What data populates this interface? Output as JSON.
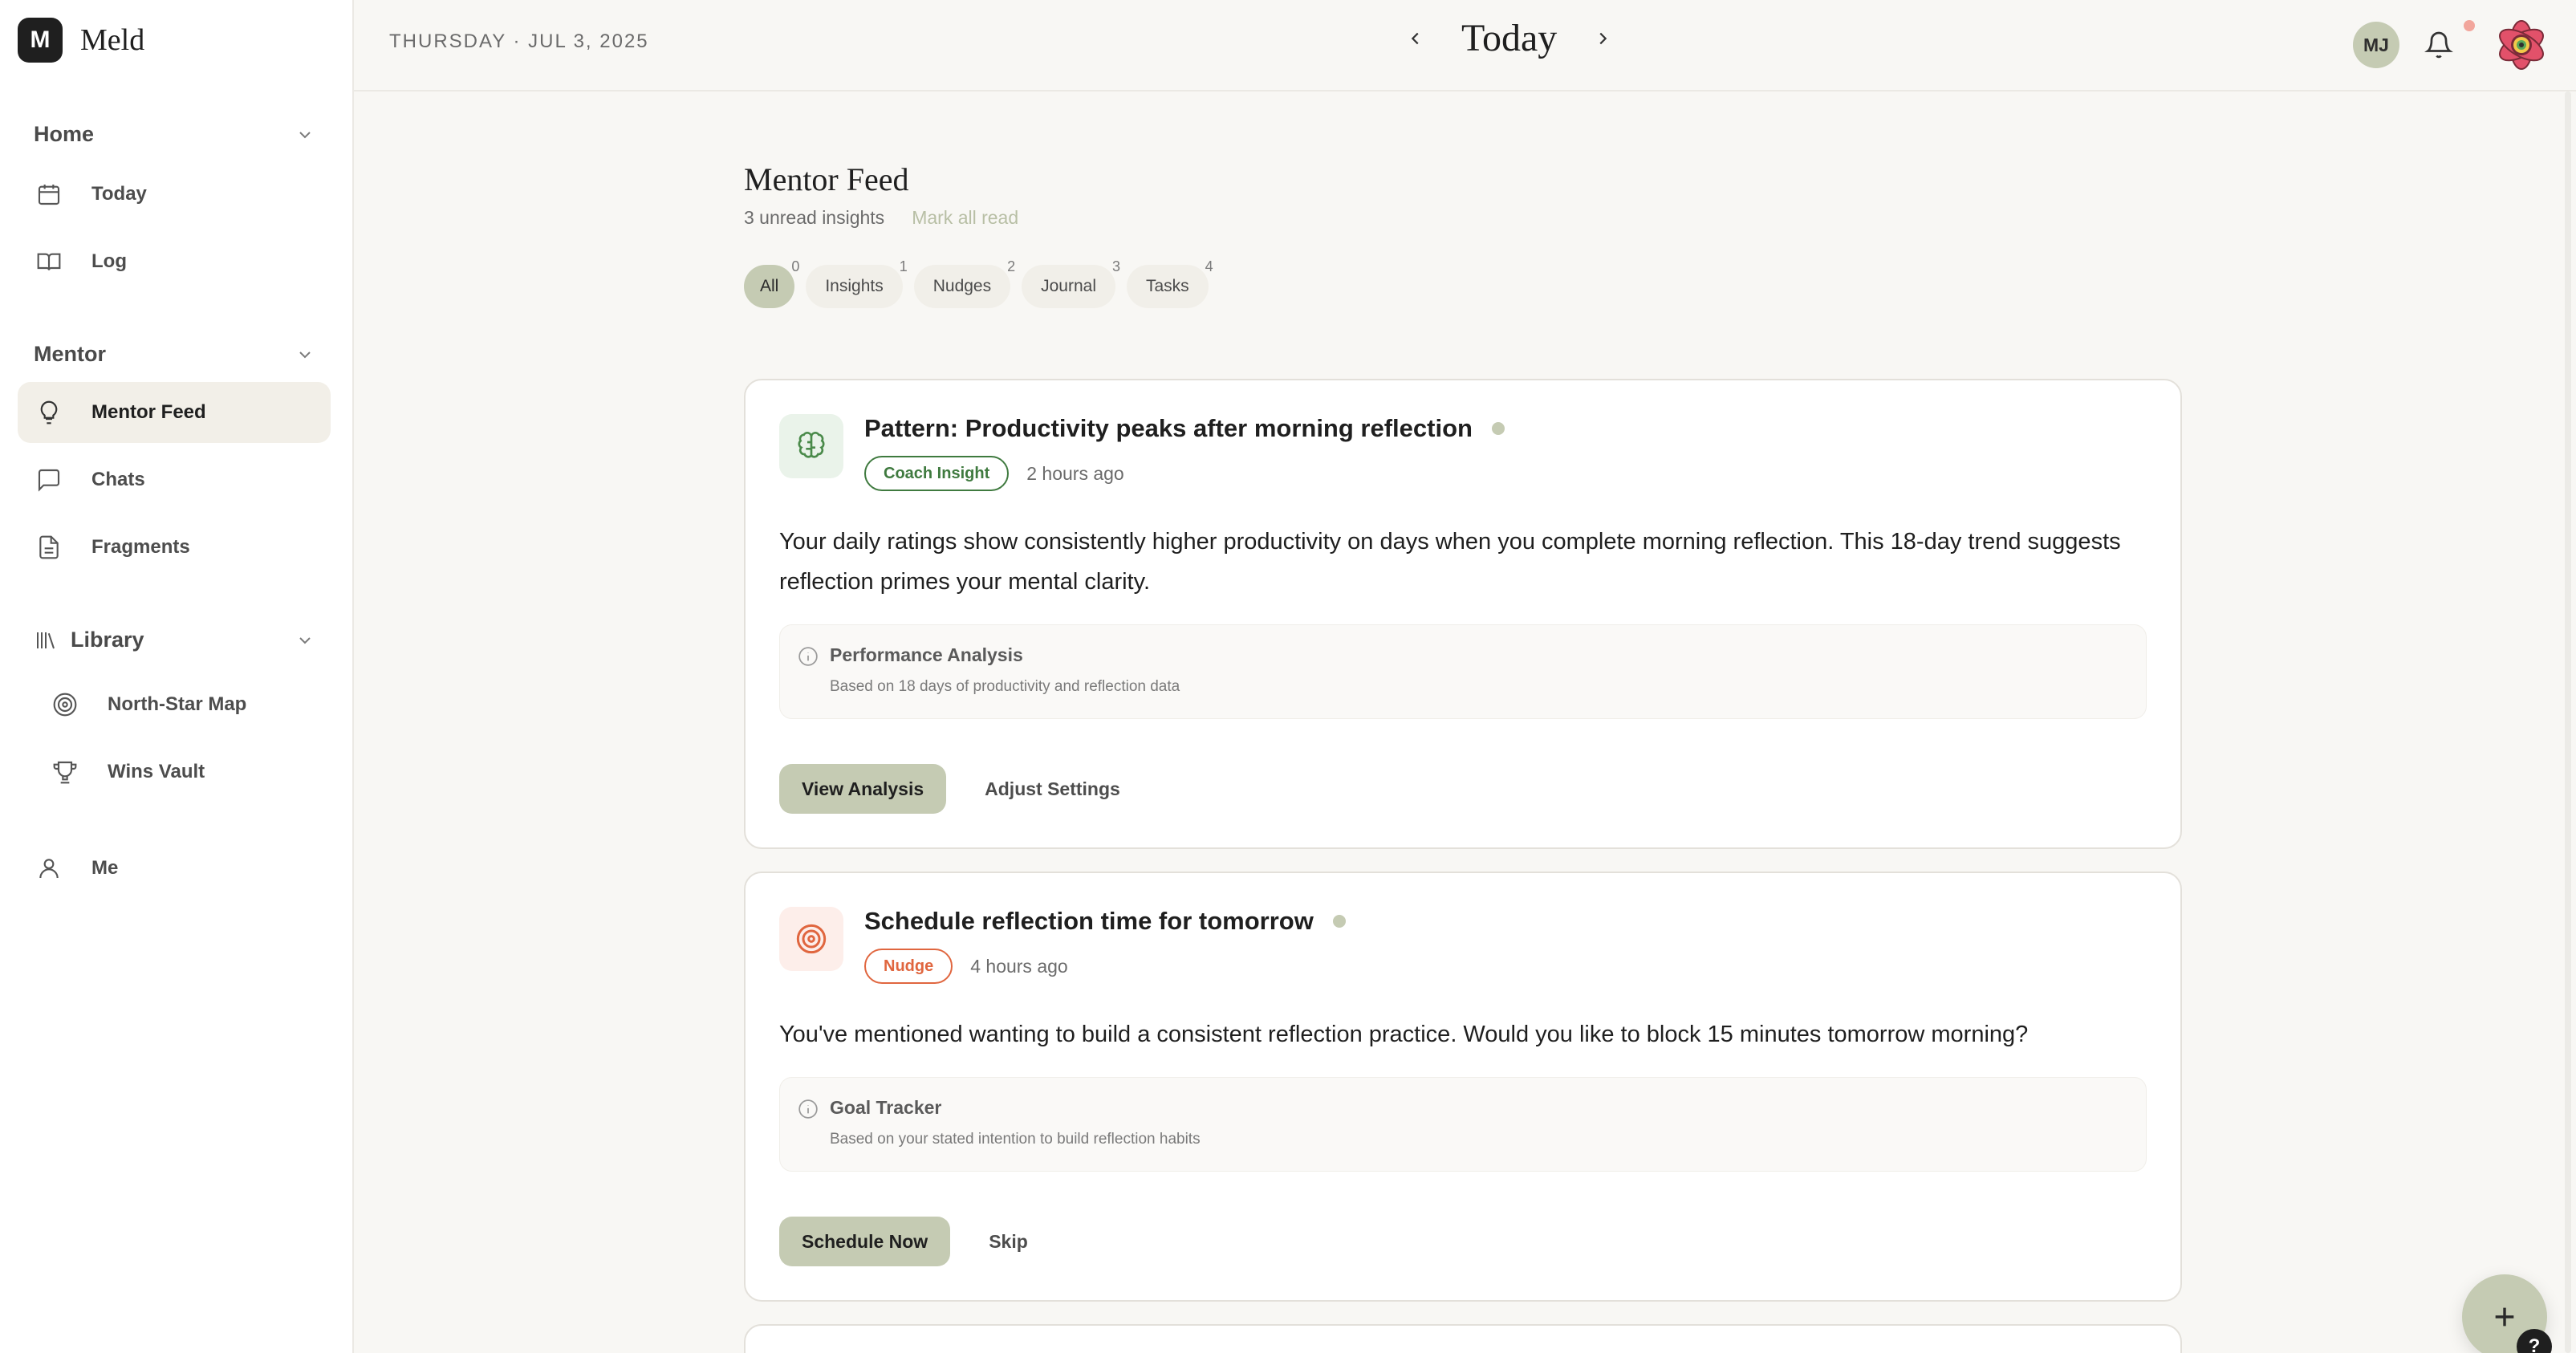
{
  "app": {
    "name": "Meld",
    "logo_letter": "M"
  },
  "sidebar": {
    "home": {
      "label": "Home",
      "items": [
        {
          "label": "Today",
          "icon": "calendar-icon"
        },
        {
          "label": "Log",
          "icon": "book-icon"
        }
      ]
    },
    "mentor": {
      "label": "Mentor",
      "items": [
        {
          "label": "Mentor Feed",
          "icon": "lightbulb-icon",
          "active": true
        },
        {
          "label": "Chats",
          "icon": "chat-icon"
        },
        {
          "label": "Fragments",
          "icon": "document-icon"
        }
      ]
    },
    "library": {
      "label": "Library",
      "items": [
        {
          "label": "North-Star Map",
          "icon": "target-icon"
        },
        {
          "label": "Wins Vault",
          "icon": "trophy-icon"
        }
      ]
    },
    "me": {
      "label": "Me",
      "icon": "user-icon"
    }
  },
  "topbar": {
    "date": "THURSDAY · JUL 3, 2025",
    "title": "Today",
    "user_initials": "MJ"
  },
  "feed": {
    "title": "Mentor Feed",
    "unread": "3 unread insights",
    "mark_all": "Mark all read",
    "filters": [
      {
        "label": "All",
        "count": "0"
      },
      {
        "label": "Insights",
        "count": "1"
      },
      {
        "label": "Nudges",
        "count": "2"
      },
      {
        "label": "Journal",
        "count": "3"
      },
      {
        "label": "Tasks",
        "count": "4"
      }
    ],
    "cards": [
      {
        "title": "Pattern: Productivity peaks after morning reflection",
        "tag": "Coach Insight",
        "time": "2 hours ago",
        "body": "Your daily ratings show consistently higher productivity on days when you complete morning reflection. This 18-day trend suggests reflection primes your mental clarity.",
        "source_title": "Performance Analysis",
        "source_desc": "Based on 18 days of productivity and reflection data",
        "primary": "View Analysis",
        "secondary": "Adjust Settings"
      },
      {
        "title": "Schedule reflection time for tomorrow",
        "tag": "Nudge",
        "time": "4 hours ago",
        "body": "You've mentioned wanting to build a consistent reflection practice. Would you like to block 15 minutes tomorrow morning?",
        "source_title": "Goal Tracker",
        "source_desc": "Based on your stated intention to build reflection habits",
        "primary": "Schedule Now",
        "secondary": "Skip"
      }
    ]
  },
  "help_label": "?",
  "colors": {
    "accent": "#c5cbb3",
    "coach": "#3f7a3f",
    "nudge": "#e0663f",
    "background": "#f8f7f4"
  }
}
